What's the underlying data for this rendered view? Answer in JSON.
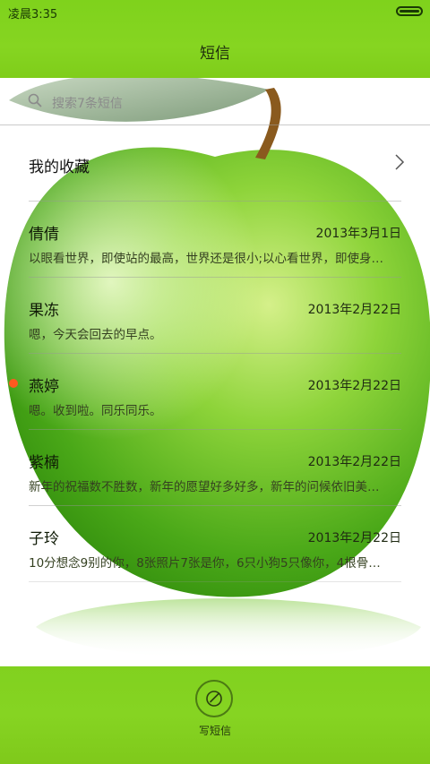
{
  "status_bar": {
    "time": "凌晨3:35"
  },
  "header": {
    "title": "短信"
  },
  "search": {
    "placeholder": "搜索7条短信"
  },
  "favorites": {
    "label": "我的收藏"
  },
  "conversations": [
    {
      "name": "倩倩",
      "date": "2013年3月1日",
      "snippet": "以眼看世界，即使站的最高，世界还是很小;以心看世界，即使身…",
      "unread": false
    },
    {
      "name": "果冻",
      "date": "2013年2月22日",
      "snippet": "嗯，今天会回去的早点。",
      "unread": false
    },
    {
      "name": "燕婷",
      "date": "2013年2月22日",
      "snippet": "嗯。收到啦。同乐同乐。",
      "unread": true
    },
    {
      "name": "紫楠",
      "date": "2013年2月22日",
      "snippet": "新年的祝福数不胜数，新年的愿望好多好多，新年的问候依旧美…",
      "unread": false
    },
    {
      "name": "子玲",
      "date": "2013年2月22日",
      "snippet": "10分想念9别的你，8张照片7张是你，6只小狗5只像你，4根骨…",
      "unread": false
    }
  ],
  "bottom": {
    "compose_label": "写短信"
  },
  "colors": {
    "accent_green": "#84d31f",
    "unread_dot": "#ff5a1f"
  }
}
